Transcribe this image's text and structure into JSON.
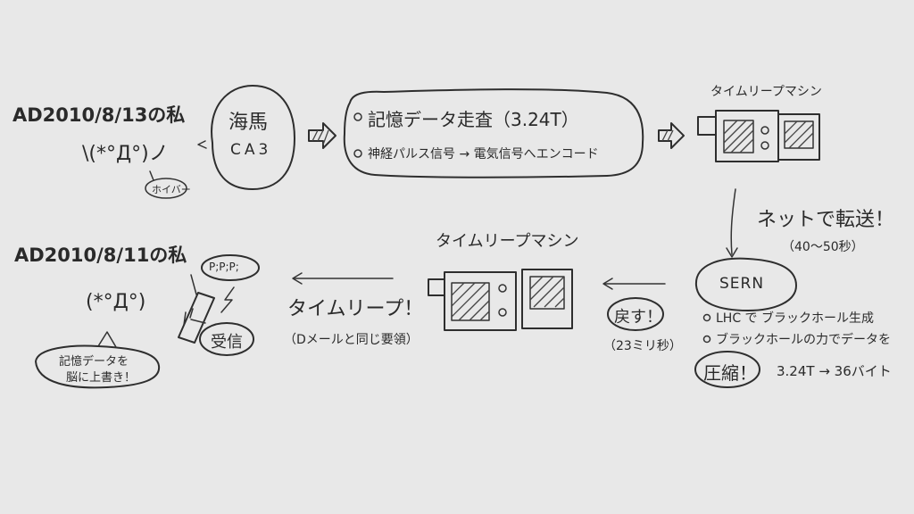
{
  "top_row": {
    "date": "AD2010/8/13の私",
    "face": "\\(*°Д°)ノ",
    "face_tag": "ホイバー",
    "hippocampus": {
      "line1": "海馬",
      "line2": "CA3"
    },
    "process": {
      "item1": "記憶データ走査（3.24T）",
      "item2": "神経パルス信号 → 電気信号へエンコード"
    },
    "machine_label": "タイムリープマシン"
  },
  "transfer": {
    "label": "ネットで転送！",
    "time": "（40～50秒）"
  },
  "sern": {
    "name": "SERN",
    "note1": "LHC で ブラックホール生成",
    "note2": "ブラックホールの力でデータを",
    "compress_badge": "圧縮！",
    "compress_value": "3.24T → 36バイト"
  },
  "return_step": {
    "label": "戻す！",
    "time": "（23ミリ秒）"
  },
  "middle": {
    "machine_label": "タイムリープマシン",
    "leap_label": "タイムリープ！",
    "leap_note": "（Dメールと同じ要領）"
  },
  "bottom_row": {
    "date": "AD2010/8/11の私",
    "face": "(*°Д°)",
    "phone_sound": "P;P;P;",
    "receive_badge": "受信",
    "overwrite": {
      "line1": "記憶データを",
      "line2": "脳に上書き！"
    }
  }
}
